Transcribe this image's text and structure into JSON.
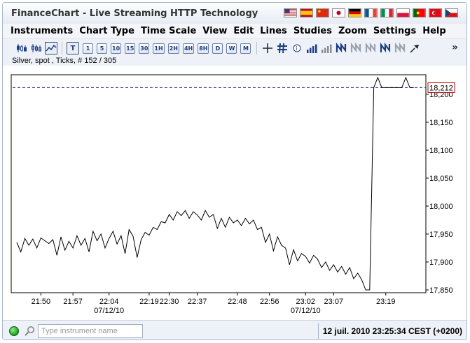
{
  "window": {
    "title": "FinanceChart - Live Streaming HTTP Technology",
    "flags": [
      {
        "name": "us-flag-icon",
        "colors": [
          "#b22234",
          "#ffffff",
          "#3c3b6e"
        ]
      },
      {
        "name": "spain-flag-icon",
        "colors": [
          "#c60b1e",
          "#ffc400",
          "#c60b1e"
        ]
      },
      {
        "name": "china-flag-icon",
        "colors": [
          "#de2910",
          "#de2910",
          "#ffde00"
        ]
      },
      {
        "name": "japan-flag-icon",
        "colors": [
          "#ffffff",
          "#bc002d",
          "#ffffff"
        ]
      },
      {
        "name": "germany-flag-icon",
        "colors": [
          "#000000",
          "#dd0000",
          "#ffce00"
        ]
      },
      {
        "name": "france-flag-icon",
        "colors": [
          "#0055a4",
          "#ffffff",
          "#ef4135"
        ]
      },
      {
        "name": "italy-flag-icon",
        "colors": [
          "#009246",
          "#ffffff",
          "#ce2b37"
        ]
      },
      {
        "name": "poland-flag-icon",
        "colors": [
          "#ffffff",
          "#dc143c",
          "#dc143c"
        ]
      },
      {
        "name": "portugal-flag-icon",
        "colors": [
          "#006600",
          "#ff0000",
          "#ff0000"
        ]
      },
      {
        "name": "turkey-flag-icon",
        "colors": [
          "#e30a17",
          "#e30a17",
          "#ffffff"
        ]
      },
      {
        "name": "czech-flag-icon",
        "colors": [
          "#ffffff",
          "#d7141a",
          "#11457e"
        ]
      }
    ]
  },
  "menu": [
    "Instruments",
    "Chart Type",
    "Time Scale",
    "View",
    "Edit",
    "Lines",
    "Studies",
    "Zoom",
    "Settings",
    "Help"
  ],
  "toolbar": {
    "chart_types": [
      "candlestick-chart-icon",
      "bar-chart-icon",
      "line-chart-icon"
    ],
    "timescales": [
      "T",
      "1",
      "5",
      "10",
      "15",
      "30",
      "1H",
      "2H",
      "4H",
      "8H",
      "D",
      "W",
      "M"
    ],
    "active_timescale": "T",
    "tools": [
      "crosshair-icon",
      "grid-icon",
      "info-icon",
      "volume-bars-icon",
      "volume-histogram-icon",
      "indicator-1-icon",
      "indicator-2-icon",
      "indicator-3-icon",
      "indicator-4-icon",
      "indicator-5-icon",
      "pin-icon"
    ],
    "more": "»"
  },
  "instrument_label": "Silver, spot , Ticks, # 152 / 305",
  "chart_data": {
    "type": "line",
    "title": "",
    "current_value": "18,212",
    "current_value_num": 18212,
    "ylim": [
      17845,
      18235
    ],
    "y_ticks": [
      {
        "label": "18,200",
        "value": 18200
      },
      {
        "label": "18,150",
        "value": 18150
      },
      {
        "label": "18,100",
        "value": 18100
      },
      {
        "label": "18,050",
        "value": 18050
      },
      {
        "label": "18,000",
        "value": 18000
      },
      {
        "label": "17,950",
        "value": 17950
      },
      {
        "label": "17,900",
        "value": 17900
      },
      {
        "label": "17,850",
        "value": 17850
      }
    ],
    "x_ticks": [
      {
        "label": "21:50",
        "index": 6
      },
      {
        "label": "21:57",
        "index": 14
      },
      {
        "label": "22:04",
        "index": 23,
        "date": "07/12/10"
      },
      {
        "label": "22:19",
        "index": 33
      },
      {
        "label": "22:30",
        "index": 38
      },
      {
        "label": "22:37",
        "index": 45
      },
      {
        "label": "22:48",
        "index": 55
      },
      {
        "label": "22:56",
        "index": 63
      },
      {
        "label": "23:02",
        "index": 72,
        "date": "07/12/10"
      },
      {
        "label": "23:07",
        "index": 79
      },
      {
        "label": "23:19",
        "index": 92
      }
    ],
    "xlim": [
      0,
      102
    ],
    "series": [
      {
        "values": [
          17935,
          17918,
          17942,
          17930,
          17941,
          17925,
          17943,
          17938,
          17933,
          17940,
          17912,
          17945,
          17921,
          17937,
          17925,
          17947,
          17930,
          17942,
          17918,
          17955,
          17938,
          17950,
          17925,
          17942,
          17955,
          17932,
          17947,
          17915,
          17958,
          17946,
          17908,
          17940,
          17953,
          17948,
          17962,
          17958,
          17972,
          17970,
          17985,
          17975,
          17990,
          17983,
          17992,
          17978,
          17990,
          17984,
          17975,
          17992,
          17980,
          17985,
          17960,
          17978,
          17962,
          17980,
          17970,
          17975,
          17965,
          17978,
          17968,
          17975,
          17958,
          17962,
          17935,
          17950,
          17920,
          17945,
          17930,
          17925,
          17895,
          17922,
          17902,
          17915,
          17910,
          17898,
          17912,
          17905,
          17890,
          17900,
          17885,
          17895,
          17882,
          17892,
          17878,
          17890,
          17870,
          17880,
          17868,
          17850,
          17850,
          18212,
          18230,
          18212,
          18212,
          18212,
          18212,
          18212,
          18212,
          18230,
          18212,
          18212
        ],
        "x": [
          0,
          1,
          2,
          3,
          4,
          5,
          6,
          7,
          8,
          9,
          10,
          11,
          12,
          13,
          14,
          15,
          16,
          17,
          18,
          19,
          20,
          21,
          22,
          23,
          24,
          25,
          26,
          27,
          28,
          29,
          30,
          31,
          32,
          33,
          34,
          35,
          36,
          37,
          38,
          39,
          40,
          41,
          42,
          43,
          44,
          45,
          46,
          47,
          48,
          49,
          50,
          51,
          52,
          53,
          54,
          55,
          56,
          57,
          58,
          59,
          60,
          61,
          62,
          63,
          64,
          65,
          66,
          67,
          68,
          69,
          70,
          71,
          72,
          73,
          74,
          75,
          76,
          77,
          78,
          79,
          80,
          81,
          82,
          83,
          84,
          85,
          86,
          87,
          88,
          89,
          90,
          91,
          92,
          93,
          94,
          95,
          96,
          97,
          98,
          99
        ]
      }
    ],
    "colors": {
      "line": "#000000",
      "current_line": "#1a2b8a",
      "current_label": "#c00000"
    }
  },
  "status": {
    "search_placeholder": "Type instrument name",
    "time": "12 juil. 2010 23:25:34  CEST (+0200)"
  }
}
